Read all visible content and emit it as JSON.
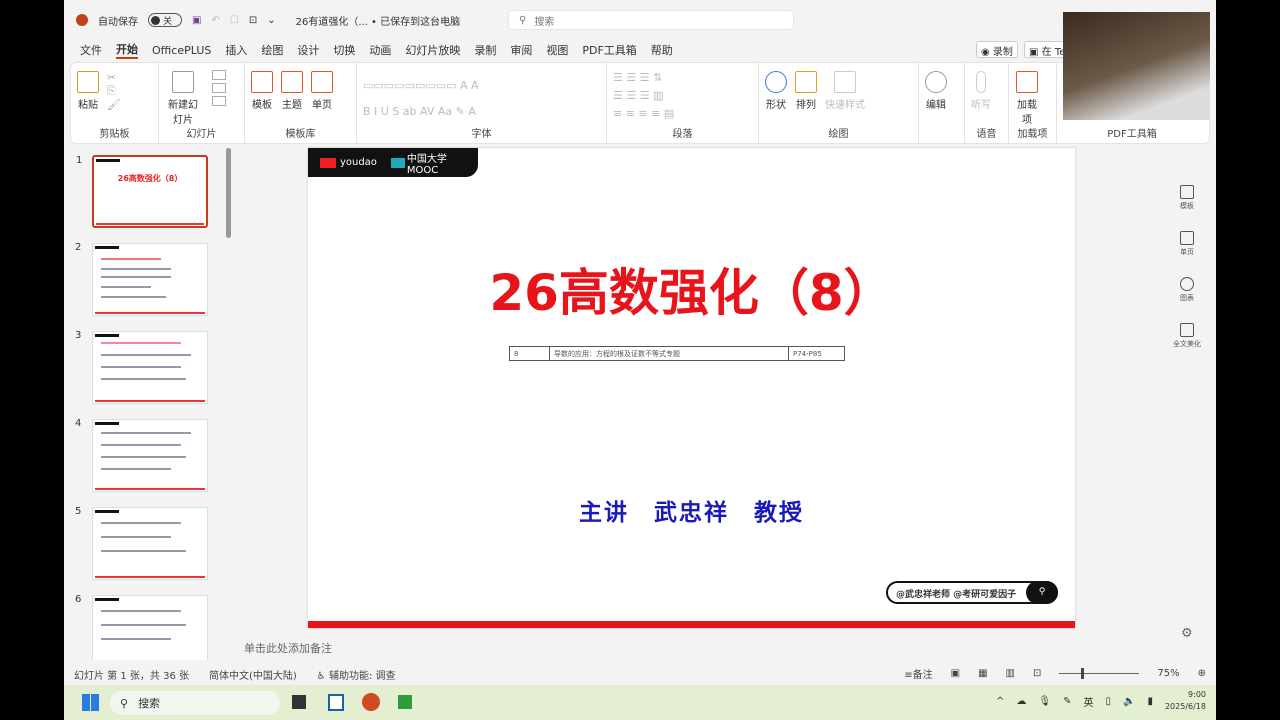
{
  "titlebar": {
    "autosave": "自动保存",
    "toggle": "关",
    "doc_title": "26有道强化（... • 已保存到这台电脑",
    "search_placeholder": "搜索"
  },
  "menu": {
    "items": [
      "文件",
      "开始",
      "OfficePLUS",
      "插入",
      "绘图",
      "设计",
      "切换",
      "动画",
      "幻灯片放映",
      "录制",
      "审阅",
      "视图",
      "PDF工具箱",
      "帮助"
    ],
    "active": "开始",
    "record": "录制",
    "teams": "在 Te"
  },
  "ribbon": {
    "groups": [
      {
        "label": "剪贴板",
        "buttons": [
          "粘贴"
        ]
      },
      {
        "label": "幻灯片",
        "buttons": [
          "新建幻灯片"
        ]
      },
      {
        "label": "模板库",
        "buttons": [
          "模板",
          "主题",
          "单页"
        ]
      },
      {
        "label": "字体",
        "buttons": []
      },
      {
        "label": "段落",
        "buttons": []
      },
      {
        "label": "绘图",
        "buttons": [
          "形状",
          "排列",
          "快速样式"
        ]
      },
      {
        "label": "",
        "buttons": [
          "编辑"
        ]
      },
      {
        "label": "语音",
        "buttons": [
          "听写"
        ]
      },
      {
        "label": "加载项",
        "buttons": [
          "加载项"
        ]
      },
      {
        "label": "PDF工具箱",
        "buttons": []
      }
    ]
  },
  "thumbnails": [
    {
      "num": "1",
      "title": "26高数强化（8）"
    },
    {
      "num": "2"
    },
    {
      "num": "3"
    },
    {
      "num": "4"
    },
    {
      "num": "5"
    },
    {
      "num": "6"
    }
  ],
  "slide": {
    "logo_youdao": "youdao",
    "logo_mooc": "中国大学MOOC",
    "title": "26高数强化（8）",
    "table": [
      [
        "8",
        "导数的应用：方程的根及证数不等式专题",
        "P74-P85"
      ]
    ],
    "lecturer": "主讲　武忠祥　教授",
    "handle": "@武忠祥老师 @考研可爱因子"
  },
  "right_panel": [
    "模板",
    "单页",
    "图表",
    "全文美化"
  ],
  "notes_placeholder": "单击此处添加备注",
  "status": {
    "slide_info": "幻灯片 第 1 张，共 36 张",
    "language": "简体中文(中国大陆)",
    "accessibility": "辅助功能: 调查",
    "notes": "备注",
    "zoom": "75%",
    "zoom_value": 75
  },
  "taskbar": {
    "search": "搜索",
    "ime": "英",
    "time": "9:00",
    "date": "2025/6/18"
  },
  "colors": {
    "accent": "#c43e1c",
    "slide_title": "#e8141b",
    "lecturer": "#1a1ab8"
  }
}
